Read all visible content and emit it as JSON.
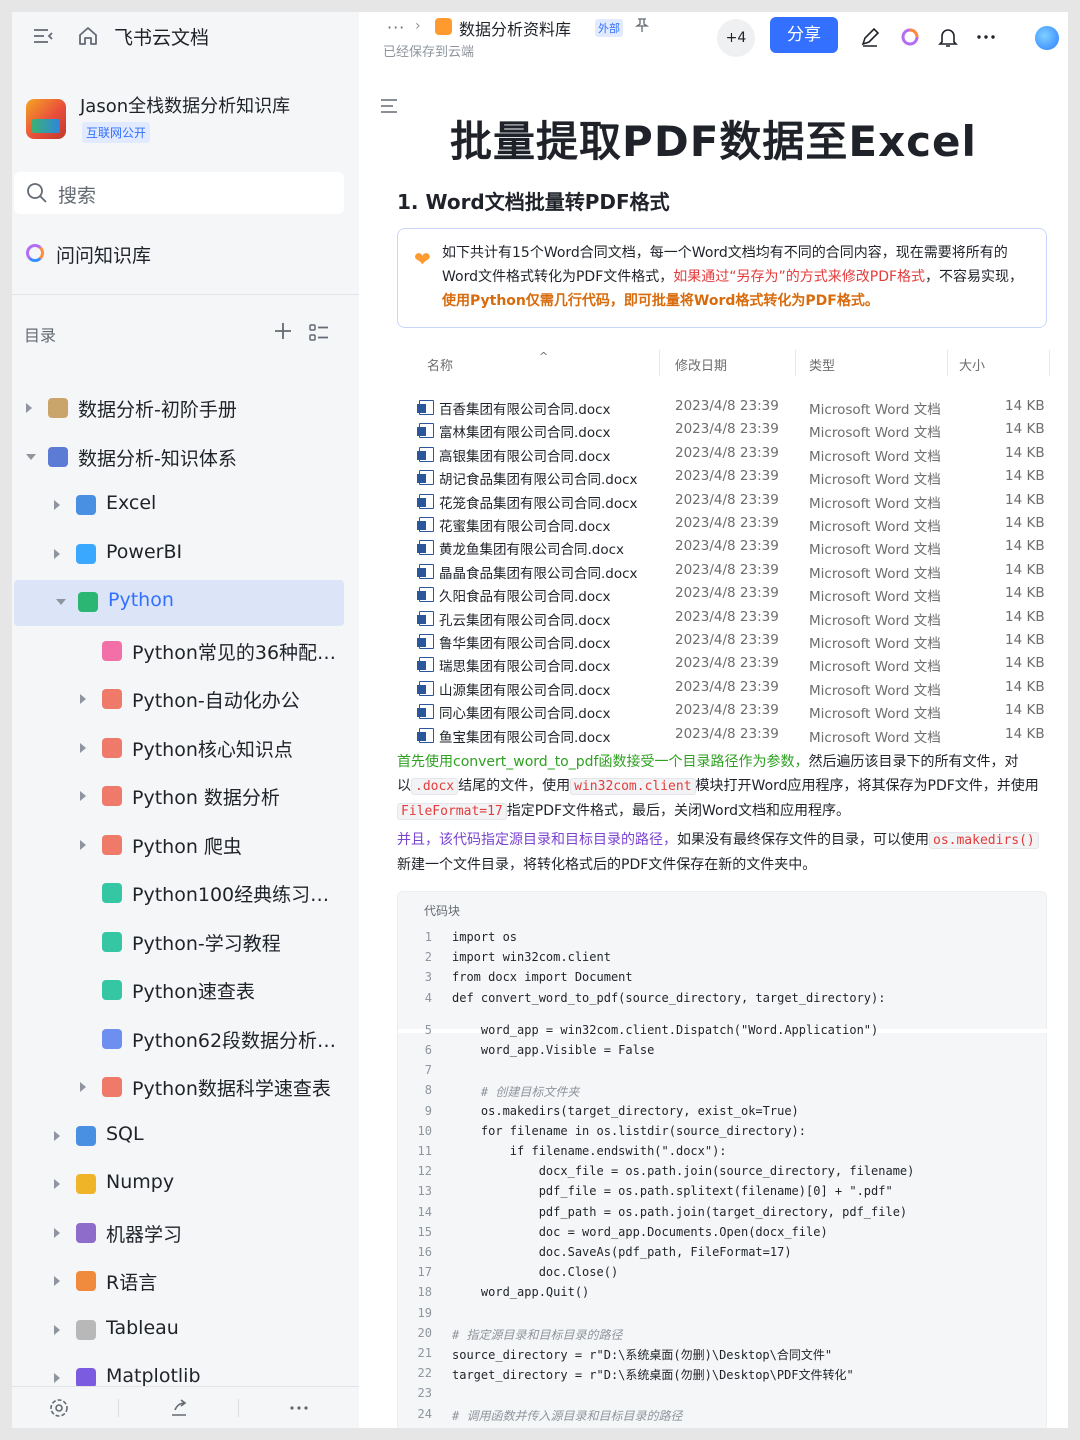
{
  "sidebar": {
    "brand": "飞书云文档",
    "kb_name": "Jason全栈数据分析知识库",
    "kb_badge": "互联网公开",
    "search_placeholder": "搜索",
    "ask_kb": "问问知识库",
    "toc_label": "目录",
    "tree": [
      {
        "label": "数据分析-初阶手册",
        "indent": 0,
        "arrow": "right",
        "icon": "hourglass-icon",
        "color": "#c9a46b"
      },
      {
        "label": "数据分析-知识体系",
        "indent": 0,
        "arrow": "down",
        "icon": "music-note-icon",
        "color": "#5b7bd5"
      },
      {
        "label": "Excel",
        "indent": 1,
        "arrow": "right",
        "icon": "excel-chart-icon",
        "color": "#4a90e2"
      },
      {
        "label": "PowerBI",
        "indent": 1,
        "arrow": "right",
        "icon": "diamond-icon",
        "color": "#3aa8ff"
      },
      {
        "label": "Python",
        "indent": 1,
        "arrow": "down",
        "icon": "python-folder-icon",
        "color": "#2bb673",
        "active": true
      },
      {
        "label": "Python常见的36种配图...",
        "indent": 2,
        "arrow": "none",
        "icon": "doc-pink-icon",
        "color": "#f36fa8"
      },
      {
        "label": "Python-自动化办公",
        "indent": 2,
        "arrow": "right",
        "icon": "doc-red-icon",
        "color": "#f07a6a"
      },
      {
        "label": "Python核心知识点",
        "indent": 2,
        "arrow": "right",
        "icon": "doc-red-icon",
        "color": "#f07a6a"
      },
      {
        "label": "Python 数据分析",
        "indent": 2,
        "arrow": "right",
        "icon": "doc-red-icon",
        "color": "#f07a6a"
      },
      {
        "label": "Python 爬虫",
        "indent": 2,
        "arrow": "right",
        "icon": "doc-red-icon",
        "color": "#f07a6a"
      },
      {
        "label": "Python100经典练习题....",
        "indent": 2,
        "arrow": "none",
        "icon": "doc-teal-icon",
        "color": "#35c6a4"
      },
      {
        "label": "Python-学习教程",
        "indent": 2,
        "arrow": "none",
        "icon": "doc-teal-icon",
        "color": "#35c6a4"
      },
      {
        "label": "Python速查表",
        "indent": 2,
        "arrow": "none",
        "icon": "doc-teal-icon",
        "color": "#35c6a4"
      },
      {
        "label": "Python62段数据分析和...",
        "indent": 2,
        "arrow": "none",
        "icon": "doc-blue-icon",
        "color": "#6f8ff0"
      },
      {
        "label": "Python数据科学速查表",
        "indent": 2,
        "arrow": "right",
        "icon": "doc-red-icon",
        "color": "#f07a6a"
      },
      {
        "label": "SQL",
        "indent": 1,
        "arrow": "right",
        "icon": "database-icon",
        "color": "#4a90e2"
      },
      {
        "label": "Numpy",
        "indent": 1,
        "arrow": "right",
        "icon": "key-icon",
        "color": "#f0b429"
      },
      {
        "label": "机器学习",
        "indent": 1,
        "arrow": "right",
        "icon": "robot-icon",
        "color": "#8e6cc9"
      },
      {
        "label": "R语言",
        "indent": 1,
        "arrow": "right",
        "icon": "r-icon",
        "color": "#f08a3c"
      },
      {
        "label": "Tableau",
        "indent": 1,
        "arrow": "right",
        "icon": "pencil-icon",
        "color": "#b8b8b8"
      },
      {
        "label": "Matplotlib",
        "indent": 1,
        "arrow": "right",
        "icon": "palette-icon",
        "color": "#7b5be0"
      }
    ]
  },
  "header": {
    "breadcrumb_more": "···",
    "breadcrumb_sep": "›",
    "doc_name": "数据分析资料库",
    "external_badge": "外部",
    "saved_status": "已经保存到云端",
    "collaborators": "+4",
    "share_label": "分享"
  },
  "doc": {
    "title": "批量提取PDF数据至Excel",
    "section1": "1. Word文档批量转PDF格式",
    "callout": {
      "part1": "如下共计有15个Word合同文档，每一个Word文档均有不同的合同内容，现在需要将所有的Word文件格式转化为PDF文件格式，",
      "part2_red": "如果通过“另存为”的方式来修改PDF格式",
      "part3": "，不容易实现，",
      "part4_orange": "使用Python仅需几行代码，即可批量将Word格式转化为PDF格式。"
    },
    "file_table": {
      "headers": {
        "name": "名称",
        "date": "修改日期",
        "type": "类型",
        "size": "大小"
      },
      "rows": [
        {
          "name": "百香集团有限公司合同.docx",
          "date": "2023/4/8 23:39",
          "type": "Microsoft Word 文档",
          "size": "14 KB"
        },
        {
          "name": "富林集团有限公司合同.docx",
          "date": "2023/4/8 23:39",
          "type": "Microsoft Word 文档",
          "size": "14 KB"
        },
        {
          "name": "高银集团有限公司合同.docx",
          "date": "2023/4/8 23:39",
          "type": "Microsoft Word 文档",
          "size": "14 KB"
        },
        {
          "name": "胡记食品集团有限公司合同.docx",
          "date": "2023/4/8 23:39",
          "type": "Microsoft Word 文档",
          "size": "14 KB"
        },
        {
          "name": "花笼食品集团有限公司合同.docx",
          "date": "2023/4/8 23:39",
          "type": "Microsoft Word 文档",
          "size": "14 KB"
        },
        {
          "name": "花蜜集团有限公司合同.docx",
          "date": "2023/4/8 23:39",
          "type": "Microsoft Word 文档",
          "size": "14 KB"
        },
        {
          "name": "黄龙鱼集团有限公司合同.docx",
          "date": "2023/4/8 23:39",
          "type": "Microsoft Word 文档",
          "size": "14 KB"
        },
        {
          "name": "晶晶食品集团有限公司合同.docx",
          "date": "2023/4/8 23:39",
          "type": "Microsoft Word 文档",
          "size": "14 KB"
        },
        {
          "name": "久阳食品有限公司合同.docx",
          "date": "2023/4/8 23:39",
          "type": "Microsoft Word 文档",
          "size": "14 KB"
        },
        {
          "name": "孔云集团有限公司合同.docx",
          "date": "2023/4/8 23:39",
          "type": "Microsoft Word 文档",
          "size": "14 KB"
        },
        {
          "name": "鲁华集团有限公司合同.docx",
          "date": "2023/4/8 23:39",
          "type": "Microsoft Word 文档",
          "size": "14 KB"
        },
        {
          "name": "瑞思集团有限公司合同.docx",
          "date": "2023/4/8 23:39",
          "type": "Microsoft Word 文档",
          "size": "14 KB"
        },
        {
          "name": "山源集团有限公司合同.docx",
          "date": "2023/4/8 23:39",
          "type": "Microsoft Word 文档",
          "size": "14 KB"
        },
        {
          "name": "同心集团有限公司合同.docx",
          "date": "2023/4/8 23:39",
          "type": "Microsoft Word 文档",
          "size": "14 KB"
        },
        {
          "name": "鱼宝集团有限公司合同.docx",
          "date": "2023/4/8 23:39",
          "type": "Microsoft Word 文档",
          "size": "14 KB"
        }
      ]
    },
    "para1": {
      "green": "首先使用convert_word_to_pdf函数接受一个目录路径作为参数，",
      "t1": "然后遍历该目录下的所有文件，对以",
      "c1": ".docx",
      "t2": "结尾的文件，使用",
      "c2": "win32com.client",
      "t3": "模块打开Word应用程序，将其保存为PDF文件，并使用",
      "c3": "FileFormat=17",
      "t4": "指定PDF文件格式，最后，关闭Word文档和应用程序。"
    },
    "para2": {
      "purple": "并且，该代码指定源目录和目标目录的路径，",
      "t1": "如果没有最终保存文件的目录，可以使用",
      "c1": "os.makedirs()",
      "t2": "新建一个文件目录，将转化格式后的PDF文件保存在新的文件夹中。"
    },
    "code_label": "代码块",
    "code_lines": [
      {
        "n": "1",
        "text": "import os"
      },
      {
        "n": "2",
        "text": "import win32com.client"
      },
      {
        "n": "3",
        "text": "from docx import Document"
      },
      {
        "n": "4",
        "text": "def convert_word_to_pdf(source_directory, target_directory):"
      },
      {
        "n": "5",
        "text": "    word_app = win32com.client.Dispatch(\"Word.Application\")"
      },
      {
        "n": "6",
        "text": "    word_app.Visible = False"
      },
      {
        "n": "7",
        "text": ""
      },
      {
        "n": "8",
        "text": "    # 创建目标文件夹"
      },
      {
        "n": "9",
        "text": "    os.makedirs(target_directory, exist_ok=True)"
      },
      {
        "n": "10",
        "text": "    for filename in os.listdir(source_directory):"
      },
      {
        "n": "11",
        "text": "        if filename.endswith(\".docx\"):"
      },
      {
        "n": "12",
        "text": "            docx_file = os.path.join(source_directory, filename)"
      },
      {
        "n": "13",
        "text": "            pdf_file = os.path.splitext(filename)[0] + \".pdf\""
      },
      {
        "n": "14",
        "text": "            pdf_path = os.path.join(target_directory, pdf_file)"
      },
      {
        "n": "15",
        "text": "            doc = word_app.Documents.Open(docx_file)"
      },
      {
        "n": "16",
        "text": "            doc.SaveAs(pdf_path, FileFormat=17)"
      },
      {
        "n": "17",
        "text": "            doc.Close()"
      },
      {
        "n": "18",
        "text": "    word_app.Quit()"
      },
      {
        "n": "19",
        "text": ""
      },
      {
        "n": "20",
        "text": "# 指定源目录和目标目录的路径"
      },
      {
        "n": "21",
        "text": "source_directory = r\"D:\\系统桌面(勿删)\\Desktop\\合同文件\""
      },
      {
        "n": "22",
        "text": "target_directory = r\"D:\\系统桌面(勿删)\\Desktop\\PDF文件转化\""
      },
      {
        "n": "23",
        "text": ""
      },
      {
        "n": "24",
        "text": "# 调用函数并传入源目录和目标目录的路径"
      }
    ]
  }
}
